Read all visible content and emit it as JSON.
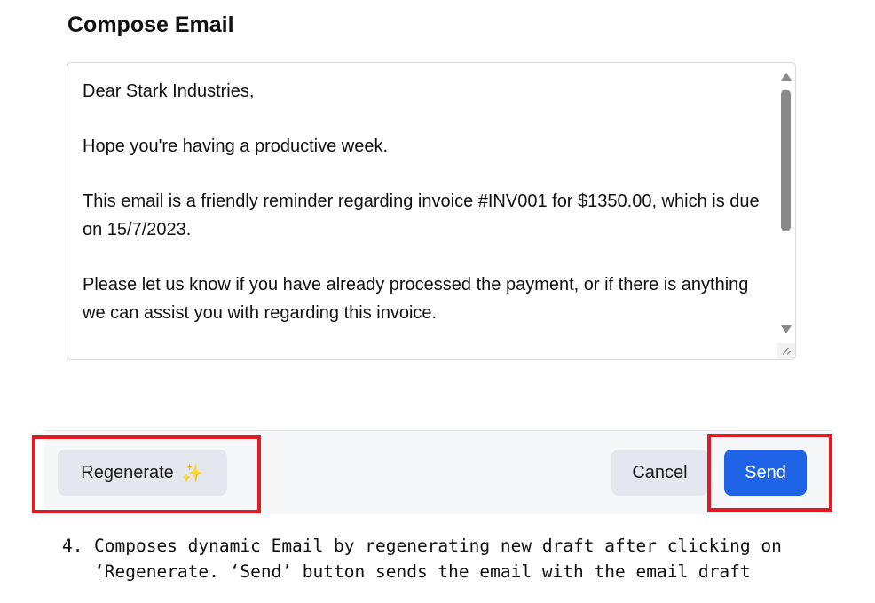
{
  "compose": {
    "title": "Compose Email",
    "body_paragraphs": [
      "Dear Stark Industries,",
      "Hope you're having a productive week.",
      "This email is a friendly reminder regarding invoice #INV001 for $1350.00, which is due on 15/7/2023.",
      "Please let us know if you have already processed the payment, or if there is anything we can assist you with regarding this invoice."
    ]
  },
  "actions": {
    "regenerate_label": "Regenerate",
    "regenerate_icon": "sparkle-icon",
    "cancel_label": "Cancel",
    "send_label": "Send"
  },
  "caption": {
    "number": "4.",
    "text": "Composes dynamic Email by regenerating new draft after clicking on ‘Regenerate. ‘Send’ button sends the email with the email draft"
  },
  "colors": {
    "send_button": "#1f63e6",
    "secondary_button": "#e4e8ee",
    "highlight_box": "#e01b24"
  }
}
